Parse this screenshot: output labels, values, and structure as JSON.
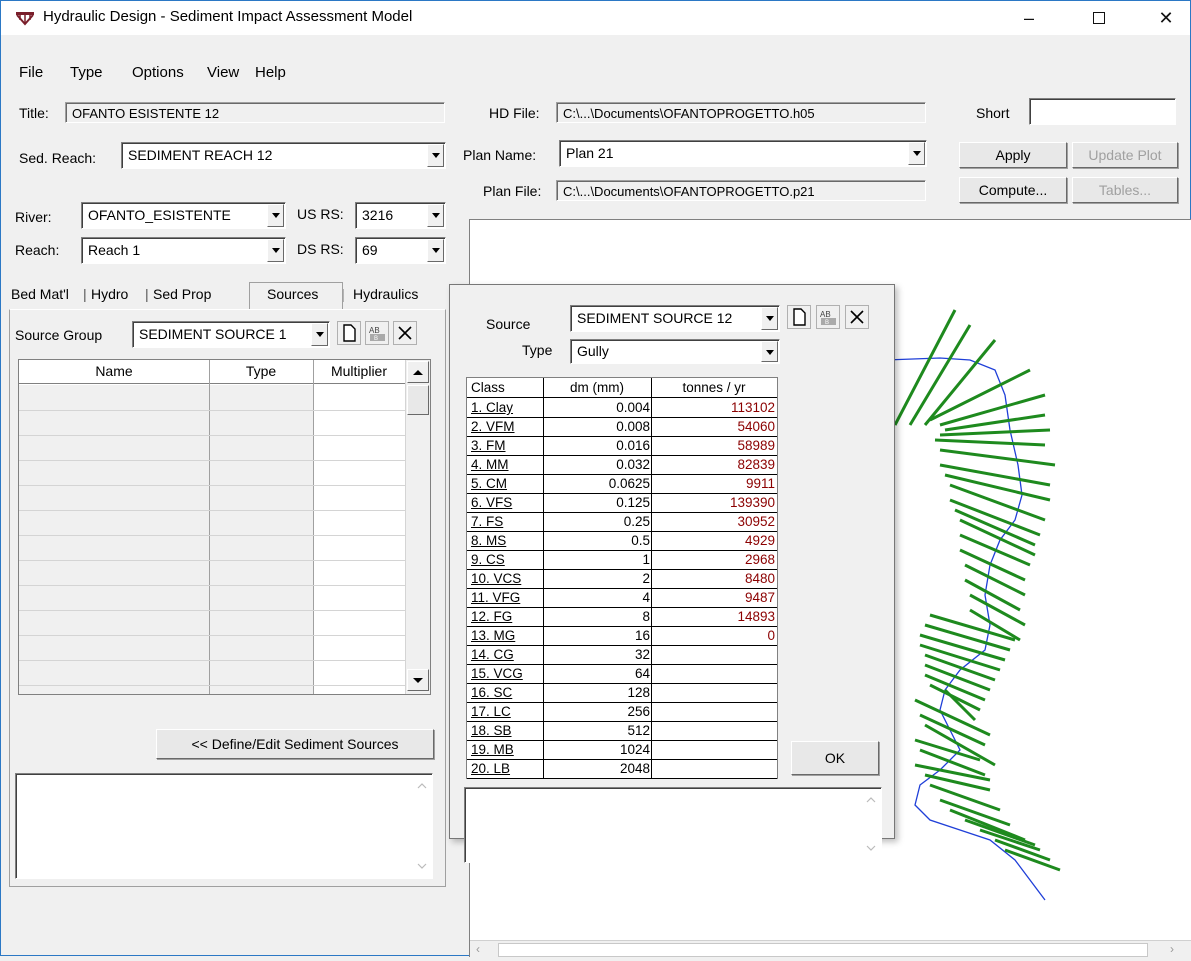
{
  "window": {
    "title": "Hydraulic Design - Sediment Impact Assessment Model"
  },
  "menu": [
    "File",
    "Type",
    "Options",
    "View",
    "Help"
  ],
  "header": {
    "title_label": "Title:",
    "title_value": "OFANTO ESISTENTE 12",
    "hd_file_label": "HD File:",
    "hd_file_value": "C:\\...\\Documents\\OFANTOPROGETTO.h05",
    "short_label": "Short",
    "short_value": "",
    "sed_reach_label": "Sed. Reach:",
    "sed_reach_value": "SEDIMENT REACH 12",
    "plan_name_label": "Plan Name:",
    "plan_name_value": "Plan 21",
    "plan_file_label": "Plan File:",
    "plan_file_value": "C:\\...\\Documents\\OFANTOPROGETTO.p21",
    "apply_label": "Apply",
    "update_plot_label": "Update Plot",
    "compute_label": "Compute...",
    "tables_label": "Tables...",
    "river_label": "River:",
    "river_value": "OFANTO_ESISTENTE",
    "us_rs_label": "US RS:",
    "us_rs_value": "3216",
    "reach_label": "Reach:",
    "reach_value": "Reach 1",
    "ds_rs_label": "DS RS:",
    "ds_rs_value": "69"
  },
  "tabs": [
    "Bed Mat'l",
    "Hydro",
    "Sed Prop",
    "Sources",
    "Hydraulics"
  ],
  "active_tab": "Sources",
  "sources_panel": {
    "group_label": "Source Group",
    "group_value": "SEDIMENT SOURCE 1",
    "columns": [
      "Name",
      "Type",
      "Multiplier"
    ],
    "define_button": "<< Define/Edit Sediment Sources"
  },
  "dialog": {
    "source_label": "Source",
    "source_value": "SEDIMENT SOURCE 12",
    "type_label": "Type",
    "type_value": "Gully",
    "columns": [
      "Class",
      "dm (mm)",
      "tonnes / yr"
    ],
    "rows": [
      {
        "cls": "1. Clay",
        "dm": "0.004",
        "t": "113102"
      },
      {
        "cls": "2. VFM",
        "dm": "0.008",
        "t": "54060"
      },
      {
        "cls": "3. FM",
        "dm": "0.016",
        "t": "58989"
      },
      {
        "cls": "4. MM",
        "dm": "0.032",
        "t": "82839"
      },
      {
        "cls": "5. CM",
        "dm": "0.0625",
        "t": "9911"
      },
      {
        "cls": "6. VFS",
        "dm": "0.125",
        "t": "139390"
      },
      {
        "cls": "7. FS",
        "dm": "0.25",
        "t": "30952"
      },
      {
        "cls": "8. MS",
        "dm": "0.5",
        "t": "4929"
      },
      {
        "cls": "9. CS",
        "dm": "1",
        "t": "2968"
      },
      {
        "cls": "10. VCS",
        "dm": "2",
        "t": "8480"
      },
      {
        "cls": "11. VFG",
        "dm": "4",
        "t": "9487"
      },
      {
        "cls": "12. FG",
        "dm": "8",
        "t": "14893"
      },
      {
        "cls": "13. MG",
        "dm": "16",
        "t": "0"
      },
      {
        "cls": "14. CG",
        "dm": "32",
        "t": ""
      },
      {
        "cls": "15. VCG",
        "dm": "64",
        "t": ""
      },
      {
        "cls": "16. SC",
        "dm": "128",
        "t": ""
      },
      {
        "cls": "17. LC",
        "dm": "256",
        "t": ""
      },
      {
        "cls": "18. SB",
        "dm": "512",
        "t": ""
      },
      {
        "cls": "19. MB",
        "dm": "1024",
        "t": ""
      },
      {
        "cls": "20. LB",
        "dm": "2048",
        "t": ""
      }
    ],
    "ok_label": "OK"
  },
  "colors": {
    "xs_green": "#1e8a1e",
    "river_blue": "#1f3fd8",
    "value_red": "#8b0000"
  }
}
